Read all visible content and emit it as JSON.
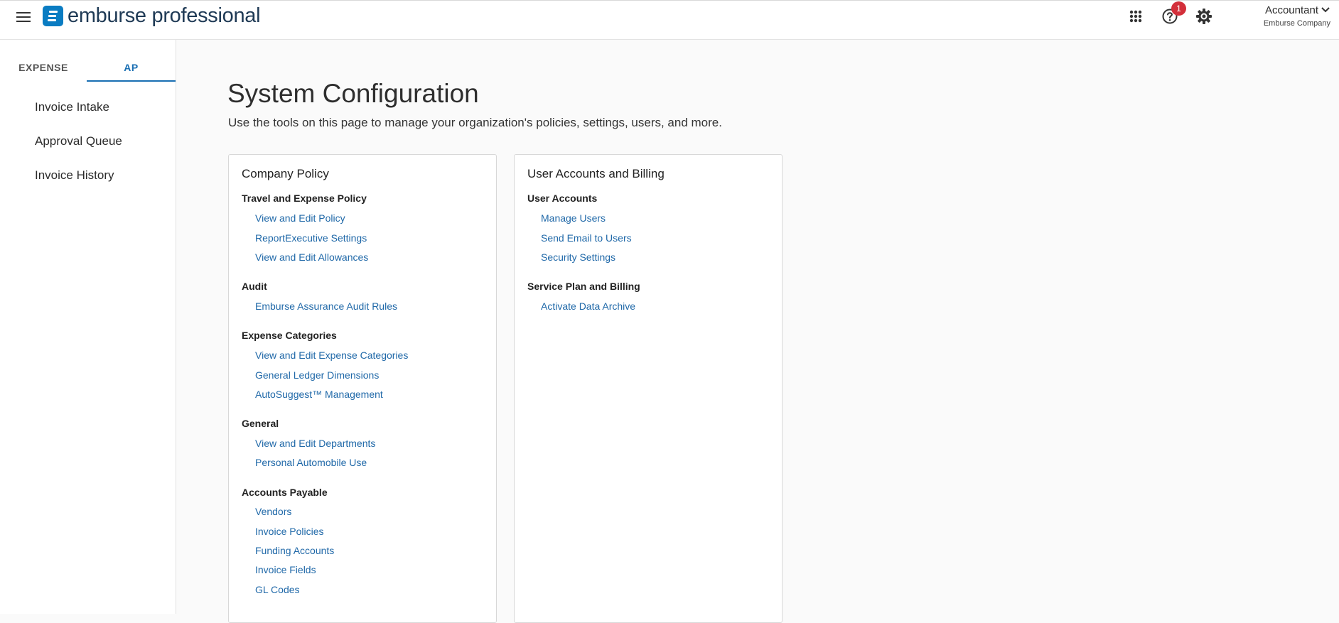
{
  "header": {
    "logo_text": "emburse professional",
    "notification_count": "1",
    "account_name": "Accountant",
    "account_company": "Emburse Company"
  },
  "colors": {
    "accent": "#1a6fb3",
    "brand": "#0a7cc2",
    "link": "#1f68a8",
    "badge": "#d32f3a"
  },
  "icons": [
    "menu-icon",
    "apps-grid-icon",
    "help-icon",
    "settings-gear-icon",
    "chevron-down-icon"
  ],
  "sidebar": {
    "tabs": [
      {
        "label": "EXPENSE"
      },
      {
        "label": "AP"
      }
    ],
    "items": [
      {
        "label": "Invoice Intake"
      },
      {
        "label": "Approval Queue"
      },
      {
        "label": "Invoice History"
      }
    ]
  },
  "main": {
    "title": "System Configuration",
    "subtitle": "Use the tools on this page to manage your organization's policies, settings, users, and more.",
    "company_policy": {
      "title": "Company Policy",
      "travel": {
        "heading": "Travel and Expense Policy",
        "links": [
          "View and Edit Policy",
          "ReportExecutive Settings",
          "View and Edit Allowances"
        ]
      },
      "audit": {
        "heading": "Audit",
        "links": [
          "Emburse Assurance Audit Rules"
        ]
      },
      "expense_categories": {
        "heading": "Expense Categories",
        "links": [
          "View and Edit Expense Categories",
          "General Ledger Dimensions",
          "AutoSuggest™ Management"
        ]
      },
      "general": {
        "heading": "General",
        "links": [
          "View and Edit Departments",
          "Personal Automobile Use"
        ]
      },
      "accounts_payable": {
        "heading": "Accounts Payable",
        "links": [
          "Vendors",
          "Invoice Policies",
          "Funding Accounts",
          "Invoice Fields",
          "GL Codes"
        ]
      }
    },
    "user_accounts_billing": {
      "title": "User Accounts and Billing",
      "user_accounts": {
        "heading": "User Accounts",
        "links": [
          "Manage Users",
          "Send Email to Users",
          "Security Settings"
        ]
      },
      "service_plan": {
        "heading": "Service Plan and Billing",
        "links": [
          "Activate Data Archive"
        ]
      }
    }
  }
}
